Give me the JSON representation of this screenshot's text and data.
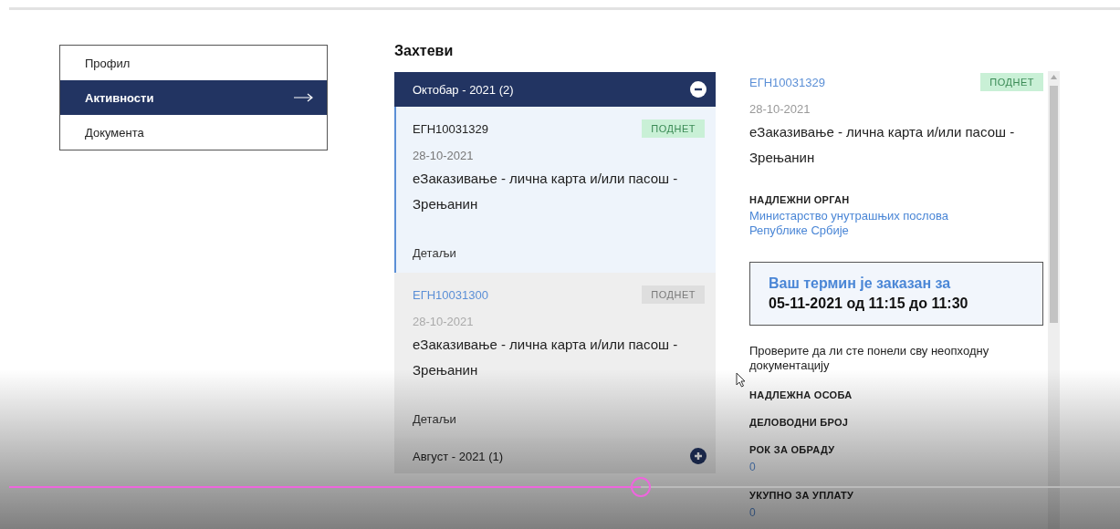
{
  "sidebar": {
    "items": [
      {
        "label": "Профил",
        "selected": false
      },
      {
        "label": "Активности",
        "selected": true
      },
      {
        "label": "Документа",
        "selected": false
      }
    ]
  },
  "requests": {
    "title": "Захтеви",
    "groups": [
      {
        "label": "Октобар - 2021 (2)",
        "expanded": true,
        "items": [
          {
            "id": "ЕГН10031329",
            "status": "ПОДНЕТ",
            "date": "28-10-2021",
            "title": "еЗаказивање - лична карта и/или пасош - Зрењанин",
            "details": "Детаљи",
            "selected": true
          },
          {
            "id": "ЕГН10031300",
            "status": "ПОДНЕТ",
            "date": "28-10-2021",
            "title": "еЗаказивање - лична карта и/или пасош - Зрењанин",
            "details": "Детаљи",
            "selected": false
          }
        ]
      },
      {
        "label": "Август - 2021 (1)",
        "expanded": false
      }
    ]
  },
  "detail": {
    "id": "ЕГН10031329",
    "status": "ПОДНЕТ",
    "date": "28-10-2021",
    "title": "еЗаказивање - лична карта и/или пасош - Зрењанин",
    "authority_label": "НАДЛЕЖНИ ОРГАН",
    "authority": "Министарство унутрашњих послова Републике Србије",
    "appointment_heading": "Ваш термин је заказан за",
    "appointment_time": "05-11-2021 од 11:15 до 11:30",
    "note": "Проверите да ли сте понели сву неопходну документацију",
    "fields": [
      {
        "label": "НАДЛЕЖНА ОСОБА"
      },
      {
        "label": "ДЕЛОВОДНИ БРОЈ"
      },
      {
        "label": "РОК ЗА ОБРАДУ",
        "value": "0"
      },
      {
        "label": "УКУПНО ЗА УПЛАТУ",
        "value": "0"
      }
    ]
  },
  "player": {
    "progress": {
      "level": 0.57
    }
  }
}
